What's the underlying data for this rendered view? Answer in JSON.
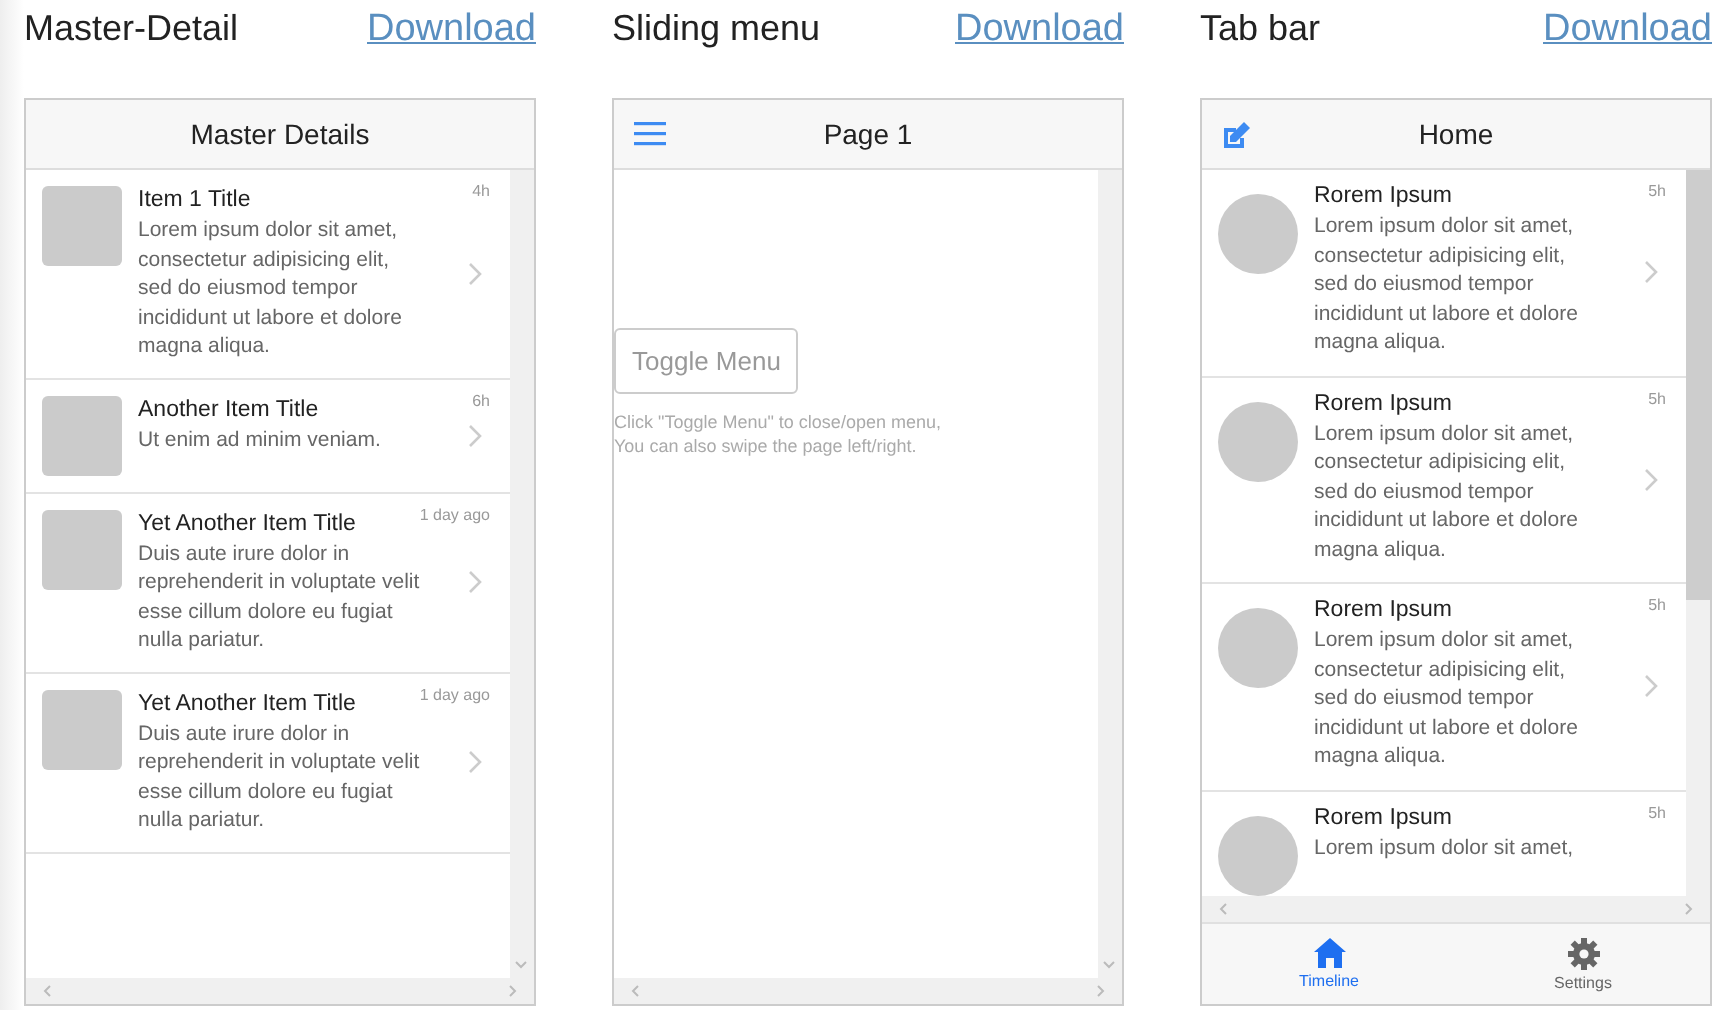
{
  "demos": [
    {
      "kind": "master",
      "title": "Master-Detail",
      "link": "Download",
      "header": "Master Details",
      "items": [
        {
          "title": "Item 1 Title",
          "time": "4h",
          "body": "Lorem ipsum dolor sit amet, consectetur adipisicing elit, sed do eiusmod tempor incididunt ut labore et dolore magna aliqua."
        },
        {
          "title": "Another Item Title",
          "time": "6h",
          "body": "Ut enim ad minim veniam."
        },
        {
          "title": "Yet Another Item Title",
          "time": "1 day ago",
          "body": "Duis aute irure dolor in reprehenderit in voluptate velit esse cillum dolore eu fugiat nulla pariatur."
        },
        {
          "title": "Yet Another Item Title",
          "time": "1 day ago",
          "body": "Duis aute irure dolor in reprehenderit in voluptate velit esse cillum dolore eu fugiat nulla pariatur."
        }
      ]
    },
    {
      "kind": "sliding",
      "title": "Sliding menu",
      "link": "Download",
      "header": "Page 1",
      "button": "Toggle Menu",
      "hint": [
        "Click \"Toggle Menu\" to close/open menu,",
        "You can also swipe the page left/right."
      ]
    },
    {
      "kind": "tabs",
      "title": "Tab bar",
      "link": "Download",
      "header": "Home",
      "items": [
        {
          "title": "Rorem Ipsum",
          "time": "5h",
          "body": "Lorem ipsum dolor sit amet, consectetur adipisicing elit, sed do eiusmod tempor incididunt ut labore et dolore magna aliqua."
        },
        {
          "title": "Rorem Ipsum",
          "time": "5h",
          "body": "Lorem ipsum dolor sit amet, consectetur adipisicing elit, sed do eiusmod tempor incididunt ut labore et dolore magna aliqua."
        },
        {
          "title": "Rorem Ipsum",
          "time": "5h",
          "body": "Lorem ipsum dolor sit amet, consectetur adipisicing elit, sed do eiusmod tempor incididunt ut labore et dolore magna aliqua."
        },
        {
          "title": "Rorem Ipsum",
          "time": "5h",
          "body": "Lorem ipsum dolor sit amet,"
        }
      ],
      "tabbar": [
        {
          "kind": "home",
          "label": "Timeline",
          "selected": true
        },
        {
          "kind": "gear",
          "label": "Settings",
          "selected": false
        }
      ]
    }
  ]
}
